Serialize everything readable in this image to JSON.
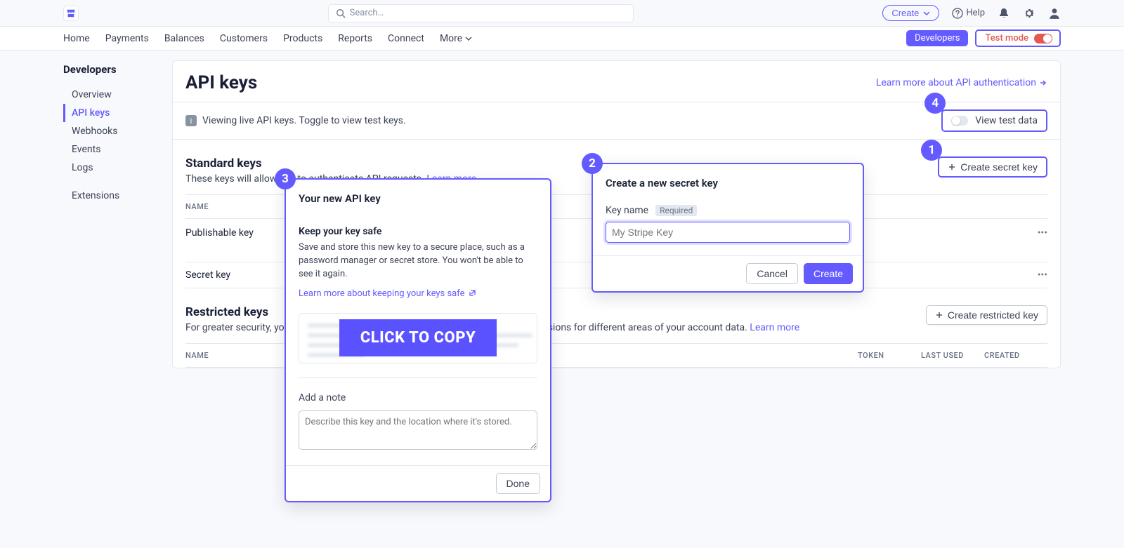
{
  "topbar": {
    "search_placeholder": "Search…",
    "create_label": "Create",
    "help_label": "Help"
  },
  "nav": {
    "items": [
      "Home",
      "Payments",
      "Balances",
      "Customers",
      "Products",
      "Reports",
      "Connect"
    ],
    "more_label": "More",
    "developers_label": "Developers",
    "testmode_label": "Test mode"
  },
  "sidebar": {
    "title": "Developers",
    "items": [
      "Overview",
      "API keys",
      "Webhooks",
      "Events",
      "Logs",
      "Extensions"
    ],
    "active_index": 1
  },
  "page": {
    "title": "API keys",
    "learn_auth": "Learn more about API authentication",
    "info_text": "Viewing live API keys. Toggle to view test keys.",
    "view_test_label": "View test data"
  },
  "standard": {
    "title": "Standard keys",
    "desc_prefix": "These keys will allow you to authenticate API requests. ",
    "learn_more": "Learn more",
    "create_btn": "Create secret key",
    "columns": {
      "name": "NAME"
    },
    "rows": [
      {
        "name": "Publishable key"
      },
      {
        "name": "Secret key"
      }
    ]
  },
  "restricted": {
    "title": "Restricted keys",
    "desc_prefix": "For greater security, you can create restricted API keys that limit access and permissions for different areas of your account data. ",
    "learn_more": "Learn more",
    "create_btn": "Create restricted key",
    "columns": {
      "name": "NAME",
      "token": "TOKEN",
      "last_used": "LAST USED",
      "created": "CREATED"
    }
  },
  "dialog_create": {
    "title": "Create a new secret key",
    "key_name_label": "Key name",
    "required_label": "Required",
    "placeholder": "My Stripe Key",
    "cancel": "Cancel",
    "create": "Create"
  },
  "dialog_newkey": {
    "title": "Your new API key",
    "safe_title": "Keep your key safe",
    "safe_desc": "Save and store this new key to a secure place, such as a password manager or secret store. You won't be able to see it again.",
    "safe_link": "Learn more about keeping your keys safe",
    "copy_label": "CLICK TO COPY",
    "note_label": "Add a note",
    "note_placeholder": "Describe this key and the location where it's stored.",
    "done": "Done"
  },
  "steps": {
    "s1": "1",
    "s2": "2",
    "s3": "3",
    "s4": "4"
  },
  "colors": {
    "accent": "#635bff",
    "orange": "#e25950",
    "border": "#e3e8ee",
    "textMuted": "#697386"
  }
}
